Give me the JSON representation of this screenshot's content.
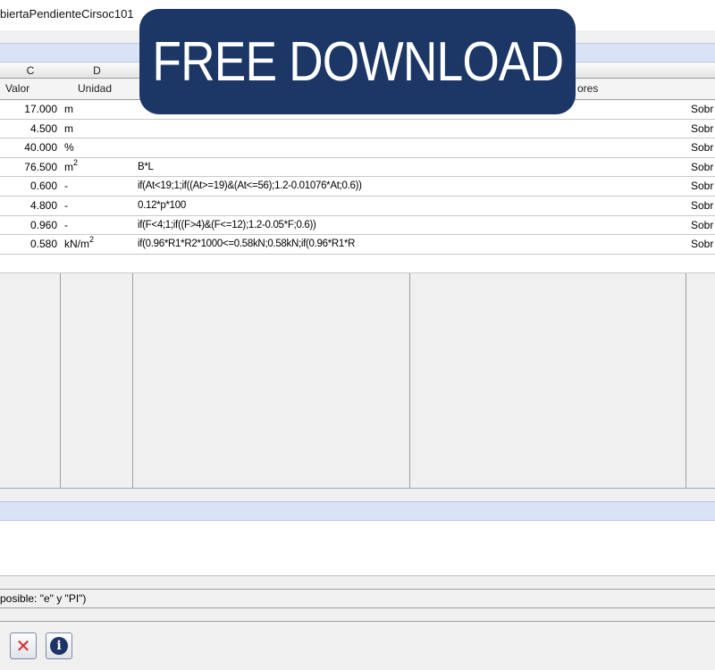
{
  "window": {
    "title": "biertaPendienteCirsoc101"
  },
  "banner": {
    "text": "FREE DOWNLOAD"
  },
  "sheet": {
    "columns": [
      "C",
      "D",
      "",
      "",
      ""
    ],
    "headers": {
      "valor": "Valor",
      "unidad": "Unidad",
      "observaciones": "ores"
    },
    "rows": [
      {
        "value": "17.000",
        "unit": "m",
        "unit_exp": "",
        "expr": "",
        "last": "Sobr"
      },
      {
        "value": "4.500",
        "unit": "m",
        "unit_exp": "",
        "expr": "",
        "last": "Sobr"
      },
      {
        "value": "40.000",
        "unit": "%",
        "unit_exp": "",
        "expr": "",
        "last": "Sobr"
      },
      {
        "value": "76.500",
        "unit": "m",
        "unit_exp": "2",
        "expr": "B*L",
        "last": "Sobr"
      },
      {
        "value": "0.600",
        "unit": "-",
        "unit_exp": "",
        "expr": "if(At<19;1;if((At>=19)&(At<=56);1.2-0.01076*At;0.6))",
        "last": "Sobr"
      },
      {
        "value": "4.800",
        "unit": "-",
        "unit_exp": "",
        "expr": "0.12*p*100",
        "last": "Sobr"
      },
      {
        "value": "0.960",
        "unit": "-",
        "unit_exp": "",
        "expr": "if(F<4;1;if((F>4)&(F<=12);1.2-0.05*F;0.6))",
        "last": "Sobr"
      },
      {
        "value": "0.580",
        "unit": "kN/m",
        "unit_exp": "2",
        "expr": "if(0.96*R1*R2*1000<=0.58kN;0.58kN;if(0.96*R1*R",
        "last": "Sobr"
      }
    ]
  },
  "status": {
    "text": "posible: \"e\" y \"PI\")"
  },
  "toolbar": {
    "buttons": [
      "cancel-icon",
      "info-icon"
    ],
    "cancel_color": "#d9262b",
    "info_color": "#1d3566"
  },
  "colors": {
    "banner_bg": "#1c3766",
    "strip_bg": "#d9e3f5"
  }
}
